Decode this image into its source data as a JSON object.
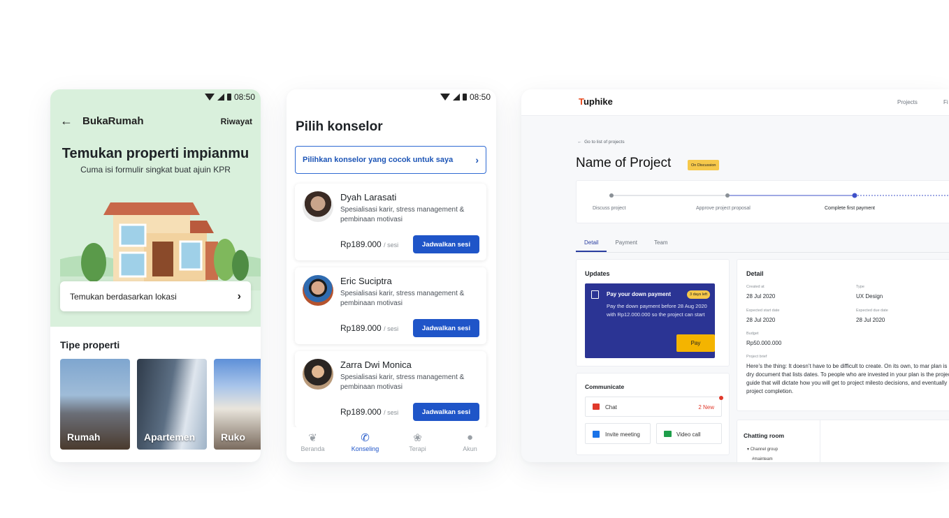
{
  "phone1": {
    "status_time": "08:50",
    "back_icon": "arrow-left-icon",
    "app_title": "BukaRumah",
    "history_link": "Riwayat",
    "headline": "Temukan properti impianmu",
    "subheadline": "Cuma isi formulir singkat buat ajuin KPR",
    "location_button": "Temukan berdasarkan lokasi",
    "section_title": "Tipe properti",
    "property_types": [
      "Rumah",
      "Apartemen",
      "Ruko"
    ],
    "colors": {
      "hero_bg": "#d9f0dc"
    }
  },
  "phone2": {
    "status_time": "08:50",
    "title": "Pilih konselor",
    "pick_button": "Pilihkan konselor yang cocok untuk saya",
    "counselors": [
      {
        "name": "Dyah Larasati",
        "desc": "Spesialisasi karir, stress management & pembinaan motivasi",
        "price": "Rp189.000",
        "unit": "/ sesi",
        "button": "Jadwalkan sesi"
      },
      {
        "name": "Eric Suciptra",
        "desc": "Spesialisasi karir, stress management & pembinaan motivasi",
        "price": "Rp189.000",
        "unit": "/ sesi",
        "button": "Jadwalkan sesi"
      },
      {
        "name": "Zarra Dwi Monica",
        "desc": "Spesialisasi karir, stress management & pembinaan motivasi",
        "price": "Rp189.000",
        "unit": "/ sesi",
        "button": "Jadwalkan sesi"
      }
    ],
    "nav": [
      {
        "label": "Beranda",
        "icon": "leaf-icon",
        "active": false
      },
      {
        "label": "Konseling",
        "icon": "phone-icon",
        "active": true
      },
      {
        "label": "Terapi",
        "icon": "lotus-icon",
        "active": false
      },
      {
        "label": "Akun",
        "icon": "user-icon",
        "active": false
      }
    ],
    "colors": {
      "accent": "#1f55c8"
    }
  },
  "web": {
    "logo": "uphike",
    "logo_mark": "T",
    "nav": [
      "Projects",
      "Fi"
    ],
    "back_link": "Go to list of projects",
    "project_title": "Name of Project",
    "status_badge": "On Discussion",
    "steps": [
      "Discuss project",
      "Approve project proposal",
      "Complete first payment"
    ],
    "tabs": [
      "Detail",
      "Payment",
      "Team"
    ],
    "updates": {
      "title": "Updates",
      "card_title": "Pay your down payment",
      "deadline": "3 days left",
      "body": "Pay the down payment before 28 Aug 2020 with Rp12.000.000 so the project can start",
      "button": "Pay"
    },
    "communicate": {
      "title": "Communicate",
      "chat": "Chat",
      "chat_badge": "2 New",
      "invite": "Invite meeting",
      "video": "Video call"
    },
    "detail": {
      "title": "Detail",
      "created_label": "Created at",
      "created_value": "28 Jul 2020",
      "type_label": "Type",
      "type_value": "UX Design",
      "start_label": "Expected start date",
      "start_value": "28 Jul 2020",
      "due_label": "Expected due date",
      "due_value": "28 Jul 2020",
      "budget_label": "Budget",
      "budget_value": "Rp50.000.000",
      "brief_label": "Project brief",
      "brief": "Here’s the thing: It doesn’t have to be difficult to create. On its own, to mar plan is a dry document that lists dates. To people who are invested in your plan is the project guide that will dictate how you will get to project milesto decisions, and eventually project completion."
    },
    "chatting": {
      "title": "Chatting room",
      "group": "Channel group",
      "channel": "#mainteam"
    },
    "colors": {
      "primary": "#2a3ea0",
      "warning": "#f6c84a",
      "danger": "#e0392b"
    }
  }
}
